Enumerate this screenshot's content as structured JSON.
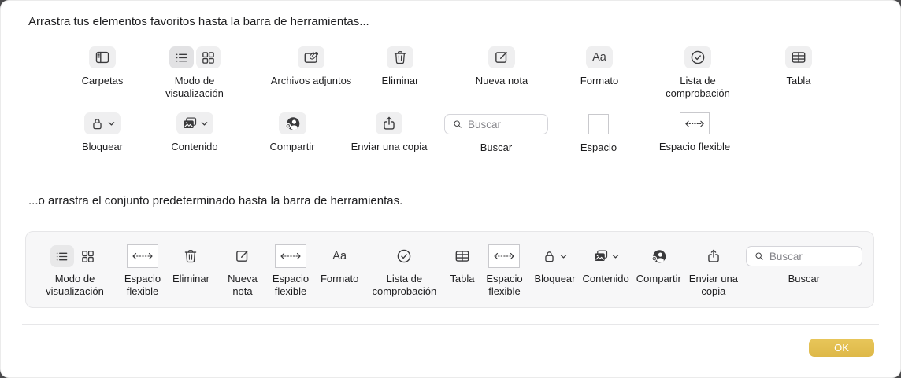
{
  "headings": {
    "favorites": "Arrastra tus elementos favoritos hasta la barra de herramientas...",
    "default_set": "...o arrastra el conjunto predeterminado hasta la barra de herramientas."
  },
  "search": {
    "placeholder": "Buscar"
  },
  "icons": {
    "format_glyph": "Aa"
  },
  "palette": {
    "row1": [
      {
        "label": "Carpetas",
        "icon": "sidebar-icon"
      },
      {
        "label": "Modo de visualización",
        "icon": "list-grid-segment"
      },
      {
        "label": "Archivos adjuntos",
        "icon": "note-paperclip-icon"
      },
      {
        "label": "Eliminar",
        "icon": "trash-icon"
      },
      {
        "label": "Nueva nota",
        "icon": "compose-icon"
      },
      {
        "label": "Formato",
        "icon": "format-aa-icon"
      },
      {
        "label": "Lista de comprobación",
        "icon": "check-circle-icon"
      },
      {
        "label": "Tabla",
        "icon": "table-icon"
      }
    ],
    "row2": [
      {
        "label": "Bloquear",
        "icon": "lock-icon"
      },
      {
        "label": "Contenido",
        "icon": "media-icon"
      },
      {
        "label": "Compartir",
        "icon": "add-person-icon"
      },
      {
        "label": "Enviar una copia",
        "icon": "share-icon"
      },
      {
        "label": "Buscar",
        "icon": "search-field"
      },
      {
        "label": "Espacio",
        "icon": "space-box"
      },
      {
        "label": "Espacio flexible",
        "icon": "flexible-space-box"
      }
    ]
  },
  "toolbar_default": {
    "items": [
      {
        "label": "Modo de visualización",
        "icon": "list-grid-segment"
      },
      {
        "label": "Espacio flexible",
        "icon": "flexible-space-box"
      },
      {
        "label": "Eliminar",
        "icon": "trash-icon"
      },
      {
        "type": "divider"
      },
      {
        "label": "Nueva nota",
        "icon": "compose-icon"
      },
      {
        "label": "Espacio flexible",
        "icon": "flexible-space-box"
      },
      {
        "label": "Formato",
        "icon": "format-aa-icon"
      },
      {
        "label": "Lista de comprobación",
        "icon": "check-circle-icon"
      },
      {
        "label": "Tabla",
        "icon": "table-icon"
      },
      {
        "label": "Espacio flexible",
        "icon": "flexible-space-box"
      },
      {
        "label": "Bloquear",
        "icon": "lock-icon"
      },
      {
        "label": "Contenido",
        "icon": "media-icon"
      },
      {
        "label": "Compartir",
        "icon": "add-person-icon"
      },
      {
        "label": "Enviar una copia",
        "icon": "share-icon"
      },
      {
        "label": "Buscar",
        "icon": "search-field"
      }
    ]
  },
  "ok_button": {
    "label": "OK"
  },
  "colors": {
    "ok_accent": "#E2BD4E",
    "icon_button_bg": "#EFEFF0",
    "bar_bg": "#F7F7F8"
  }
}
